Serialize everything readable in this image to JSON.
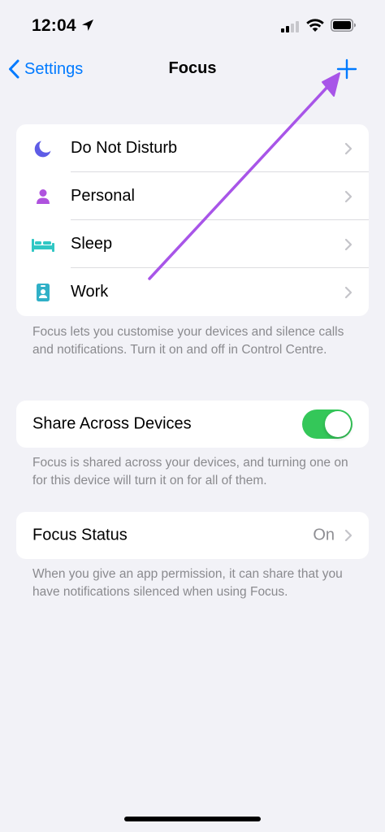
{
  "status_bar": {
    "time": "12:04"
  },
  "nav": {
    "back_label": "Settings",
    "title": "Focus"
  },
  "focus_modes": [
    {
      "label": "Do Not Disturb",
      "icon": "moon-icon",
      "color": "#5e5ce6"
    },
    {
      "label": "Personal",
      "icon": "person-icon",
      "color": "#af52de"
    },
    {
      "label": "Sleep",
      "icon": "bed-icon",
      "color": "#30c7c4"
    },
    {
      "label": "Work",
      "icon": "id-badge-icon",
      "color": "#30b0c7"
    }
  ],
  "focus_footer": "Focus lets you customise your devices and silence calls and notifications. Turn it on and off in Control Centre.",
  "share": {
    "label": "Share Across Devices",
    "enabled": true,
    "footer": "Focus is shared across your devices, and turning one on for this device will turn it on for all of them."
  },
  "focus_status": {
    "label": "Focus Status",
    "value": "On",
    "footer": "When you give an app permission, it can share that you have notifications silenced when using Focus."
  },
  "colors": {
    "accent": "#007aff",
    "toggle_on": "#34c759",
    "annotation_arrow": "#a855e8"
  }
}
